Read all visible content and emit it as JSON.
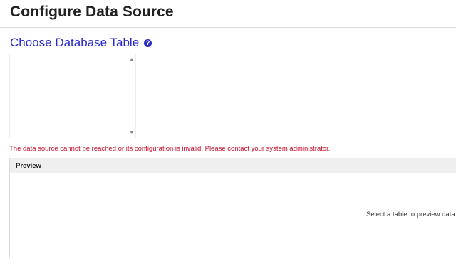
{
  "header": {
    "title": "Configure Data Source"
  },
  "section": {
    "title": "Choose Database Table",
    "help_icon": "question-circle-icon"
  },
  "table_list": {
    "items": []
  },
  "error": {
    "message": "The data source cannot be reached or its configuration is invalid. Please contact your system administrator."
  },
  "preview": {
    "header": "Preview",
    "empty_message": "Select a table to preview data"
  },
  "colors": {
    "accent": "#2a2ac8",
    "error": "#c8102e"
  }
}
